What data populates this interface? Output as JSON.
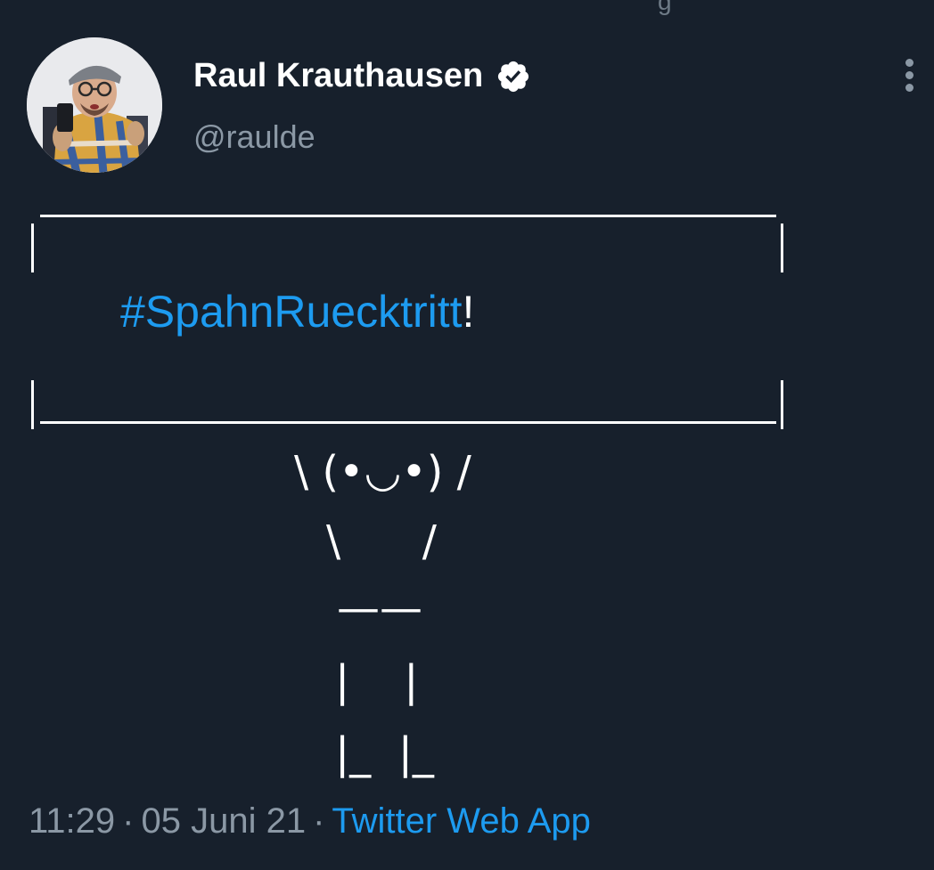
{
  "header": {
    "top_fragment": "g"
  },
  "author": {
    "display_name": "Raul Krauthausen",
    "handle": "@raulde",
    "verified_icon": "verified-badge-icon",
    "avatar_icon": "avatar"
  },
  "more_icon": "more-vertical-icon",
  "tweet": {
    "hashtag": "#SpahnRuecktritt",
    "hashtag_suffix": "!",
    "art_face": "\\ (•◡•) /",
    "art_arms": "\\      /",
    "art_waist": "——",
    "art_legs": "|    |",
    "art_feet": "|_  |_"
  },
  "meta": {
    "time": "11:29",
    "separator": "·",
    "date": "05 Juni 21",
    "source": "Twitter Web App"
  },
  "colors": {
    "background": "#17202c",
    "link": "#1d9bf0",
    "secondary_text": "#8b98a5",
    "primary_text": "#ffffff"
  }
}
